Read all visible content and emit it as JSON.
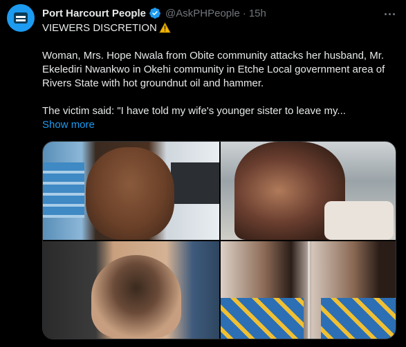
{
  "tweet": {
    "author": {
      "display_name": "Port Harcourt People",
      "handle": "@AskPHPeople",
      "verified": true,
      "avatar_icon": "news-glyph-icon",
      "avatar_color": "#1d9bf0"
    },
    "separator": "·",
    "time": "15h",
    "heading": "VIEWERS DISCRETION",
    "heading_icon": "warning-icon",
    "paragraph_1": "Woman, Mrs. Hope Nwala from Obite  community attacks her husband, Mr. Ekelediri Nwankwo in Okehi community in Etche Local government area of Rivers State with hot groundnut oil and hammer.",
    "paragraph_2": "The victim said: \"I have told my wife's younger sister to leave my...",
    "show_more": "Show more",
    "media_count": 4
  },
  "colors": {
    "background": "#000000",
    "text": "#e7e9ea",
    "muted": "#71767b",
    "link": "#1d9bf0",
    "verified": "#1d9bf0"
  }
}
